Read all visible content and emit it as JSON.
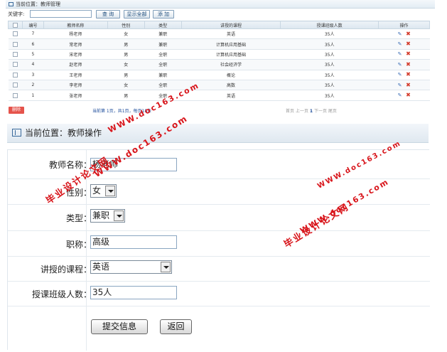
{
  "list_panel": {
    "breadcrumb": "当前位置：教师管理",
    "search_label": "关键字:",
    "search_value": "",
    "buttons": {
      "query": "查 询",
      "show_all": "显示全部",
      "add": "添 加"
    },
    "columns": [
      "编号",
      "教师名称",
      "性别",
      "类型",
      "讲授的课程",
      "授课班级人数",
      "操作"
    ],
    "rows": [
      {
        "id": "7",
        "name": "杨老师",
        "gender": "女",
        "type": "兼职",
        "course": "英语",
        "count": "35人"
      },
      {
        "id": "6",
        "name": "常老师",
        "gender": "男",
        "type": "兼职",
        "course": "计算机应用基础",
        "count": "35人"
      },
      {
        "id": "5",
        "name": "宋老师",
        "gender": "男",
        "type": "全职",
        "course": "计算机应用基础",
        "count": "35人"
      },
      {
        "id": "4",
        "name": "赵老师",
        "gender": "女",
        "type": "全职",
        "course": "社会经济学",
        "count": "35人"
      },
      {
        "id": "3",
        "name": "王老师",
        "gender": "男",
        "type": "兼职",
        "course": "概论",
        "count": "35人"
      },
      {
        "id": "2",
        "name": "李老师",
        "gender": "女",
        "type": "全职",
        "course": "高数",
        "count": "35人"
      },
      {
        "id": "1",
        "name": "张老师",
        "gender": "男",
        "type": "全职",
        "course": "英语",
        "count": "35人"
      }
    ],
    "delete_label": "删除",
    "page_info": "当前第 1页，共1页，每页18条",
    "pager": {
      "first": "首页",
      "prev": "上一页",
      "current": "1",
      "next": "下一页",
      "last": "尾页"
    }
  },
  "form_panel": {
    "breadcrumb": "当前位置：教师操作",
    "fields": {
      "name": {
        "label": "教师名称：",
        "value": "杨老师"
      },
      "gender": {
        "label": "性别：",
        "value": "女"
      },
      "type": {
        "label": "类型：",
        "value": "兼职"
      },
      "title": {
        "label": "职称：",
        "value": "高级"
      },
      "course": {
        "label": "讲授的课程：",
        "value": "英语"
      },
      "count": {
        "label": "授课班级人数：",
        "value": "35人"
      }
    },
    "submit_label": "提交信息",
    "back_label": "返回"
  },
  "watermarks": {
    "url": "WWW.doc163.com",
    "cn": "毕业设计论文网",
    "color": "#d8141a"
  }
}
